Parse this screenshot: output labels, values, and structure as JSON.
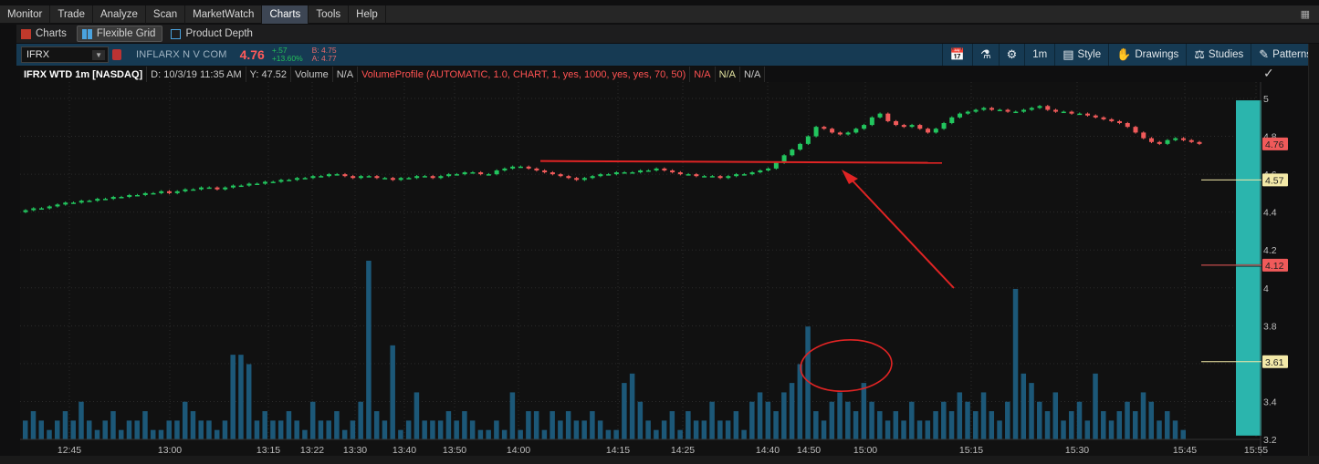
{
  "menu": {
    "items": [
      {
        "label": "Monitor"
      },
      {
        "label": "Trade"
      },
      {
        "label": "Analyze"
      },
      {
        "label": "Scan"
      },
      {
        "label": "MarketWatch"
      },
      {
        "label": "Charts",
        "active": true
      },
      {
        "label": "Tools"
      },
      {
        "label": "Help"
      }
    ]
  },
  "subtabs": {
    "charts": "Charts",
    "flexible_grid": "Flexible Grid",
    "product_depth": "Product Depth"
  },
  "toolbar": {
    "symbol": "IFRX",
    "company": "INFLARX N V COM",
    "last": "4.76",
    "change": "+.57",
    "change_pct": "+13.60%",
    "bid": "B: 4.75",
    "ask": "A: 4.77",
    "timeframe": "1m",
    "style": "Style",
    "drawings": "Drawings",
    "studies": "Studies",
    "patterns": "Patterns"
  },
  "chart_header": {
    "title": "IFRX WTD 1m [NASDAQ]",
    "date": "D: 10/3/19 11:35 AM",
    "y": "Y: 47.52",
    "volume": "Volume",
    "volume_value": "N/A",
    "volume_profile": "VolumeProfile (AUTOMATIC, 1.0, CHART, 1, yes, 1000, yes, yes, 70, 50)",
    "na1": "N/A",
    "na2": "N/A",
    "na3": "N/A"
  },
  "chart_data": {
    "type": "candlestick",
    "x_ticks": [
      "12:45",
      "13:00",
      "13:15",
      "13:22",
      "13:30",
      "13:40",
      "13:50",
      "14:00",
      "14:15",
      "14:25",
      "14:40",
      "14:50",
      "15:00",
      "15:15",
      "15:30",
      "15:45",
      "15:55"
    ],
    "y_ticks": [
      "5",
      "4.8",
      "4.6",
      "4.4",
      "4.2",
      "4",
      "3.8",
      "3.6",
      "3.4",
      "3.2"
    ],
    "ylim": [
      3.2,
      5.0
    ],
    "price_labels": [
      {
        "value": 4.76,
        "label": "4.76",
        "color": "#f05a5a"
      },
      {
        "value": 4.57,
        "label": "4.57",
        "color": "#f3e9a8"
      },
      {
        "value": 4.12,
        "label": "4.12",
        "color": "#f05a5a"
      },
      {
        "value": 3.61,
        "label": "3.61",
        "color": "#f3e9a8"
      }
    ],
    "resistance_level": 4.66,
    "candles_close": [
      4.41,
      4.42,
      4.42,
      4.43,
      4.44,
      4.45,
      4.45,
      4.46,
      4.46,
      4.47,
      4.47,
      4.48,
      4.48,
      4.49,
      4.49,
      4.5,
      4.5,
      4.51,
      4.5,
      4.51,
      4.52,
      4.52,
      4.53,
      4.53,
      4.52,
      4.53,
      4.54,
      4.54,
      4.55,
      4.55,
      4.56,
      4.56,
      4.57,
      4.57,
      4.58,
      4.58,
      4.59,
      4.59,
      4.6,
      4.6,
      4.59,
      4.58,
      4.59,
      4.59,
      4.58,
      4.58,
      4.57,
      4.58,
      4.58,
      4.59,
      4.59,
      4.58,
      4.59,
      4.6,
      4.6,
      4.61,
      4.61,
      4.6,
      4.6,
      4.62,
      4.63,
      4.64,
      4.64,
      4.63,
      4.62,
      4.61,
      4.6,
      4.59,
      4.58,
      4.57,
      4.58,
      4.59,
      4.6,
      4.6,
      4.61,
      4.61,
      4.61,
      4.62,
      4.62,
      4.63,
      4.62,
      4.61,
      4.6,
      4.6,
      4.59,
      4.59,
      4.59,
      4.58,
      4.59,
      4.6,
      4.6,
      4.61,
      4.62,
      4.63,
      4.66,
      4.7,
      4.73,
      4.76,
      4.8,
      4.85,
      4.84,
      4.82,
      4.81,
      4.82,
      4.84,
      4.86,
      4.9,
      4.92,
      4.88,
      4.86,
      4.85,
      4.86,
      4.84,
      4.82,
      4.84,
      4.87,
      4.9,
      4.92,
      4.93,
      4.94,
      4.95,
      4.94,
      4.94,
      4.93,
      4.93,
      4.94,
      4.95,
      4.96,
      4.94,
      4.93,
      4.93,
      4.92,
      4.92,
      4.91,
      4.9,
      4.89,
      4.88,
      4.87,
      4.85,
      4.82,
      4.79,
      4.77,
      4.76,
      4.78,
      4.79,
      4.78,
      4.77,
      4.76
    ],
    "volumes": [
      2,
      3,
      2,
      1,
      2,
      3,
      2,
      4,
      2,
      1,
      2,
      3,
      1,
      2,
      2,
      3,
      1,
      1,
      2,
      2,
      4,
      3,
      2,
      2,
      1,
      2,
      9,
      9,
      8,
      2,
      3,
      2,
      2,
      3,
      2,
      1,
      4,
      2,
      2,
      3,
      1,
      2,
      4,
      19,
      3,
      2,
      10,
      1,
      2,
      5,
      2,
      2,
      2,
      3,
      2,
      3,
      2,
      1,
      1,
      2,
      1,
      5,
      1,
      3,
      3,
      1,
      3,
      2,
      3,
      2,
      2,
      3,
      2,
      1,
      1,
      6,
      7,
      4,
      2,
      1,
      2,
      3,
      1,
      3,
      2,
      2,
      4,
      2,
      2,
      3,
      1,
      4,
      5,
      4,
      3,
      5,
      6,
      8,
      12,
      3,
      2,
      4,
      5,
      4,
      3,
      6,
      4,
      3,
      2,
      3,
      2,
      4,
      2,
      2,
      3,
      4,
      3,
      5,
      4,
      3,
      5,
      3,
      2,
      4,
      16,
      7,
      6,
      4,
      3,
      5,
      2,
      3,
      4,
      2,
      7,
      3,
      2,
      3,
      4,
      3,
      5,
      4,
      2,
      3,
      2,
      1
    ],
    "annotations": [
      "horizontal-line",
      "arrow",
      "circle"
    ]
  }
}
